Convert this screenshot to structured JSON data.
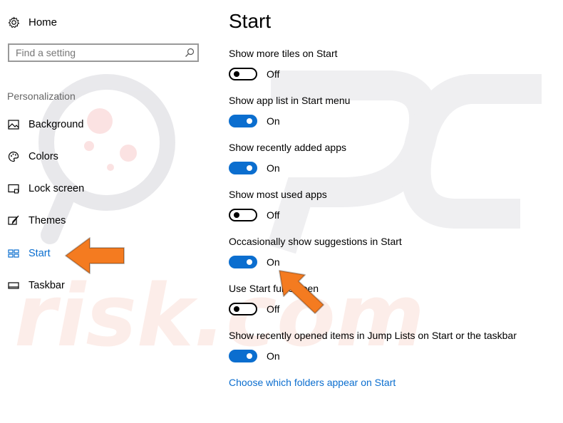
{
  "sidebar": {
    "home_label": "Home",
    "search": {
      "placeholder": "Find a setting"
    },
    "section_title": "Personalization",
    "items": [
      {
        "label": "Background",
        "icon": "picture-icon"
      },
      {
        "label": "Colors",
        "icon": "palette-icon"
      },
      {
        "label": "Lock screen",
        "icon": "lock-screen-icon"
      },
      {
        "label": "Themes",
        "icon": "brush-icon"
      },
      {
        "label": "Start",
        "icon": "start-tiles-icon",
        "active": true
      },
      {
        "label": "Taskbar",
        "icon": "taskbar-icon"
      }
    ]
  },
  "main": {
    "title": "Start",
    "settings": [
      {
        "label": "Show more tiles on Start",
        "state": "Off"
      },
      {
        "label": "Show app list in Start menu",
        "state": "On"
      },
      {
        "label": "Show recently added apps",
        "state": "On"
      },
      {
        "label": "Show most used apps",
        "state": "Off"
      },
      {
        "label": "Occasionally show suggestions in Start",
        "state": "On"
      },
      {
        "label": "Use Start full screen",
        "state": "Off"
      },
      {
        "label": "Show recently opened items in Jump Lists on Start or the taskbar",
        "state": "On"
      }
    ],
    "folders_link": "Choose which folders appear on Start"
  },
  "colors": {
    "accent": "#0b6ecf",
    "annotation_arrow": "#f47b20"
  }
}
